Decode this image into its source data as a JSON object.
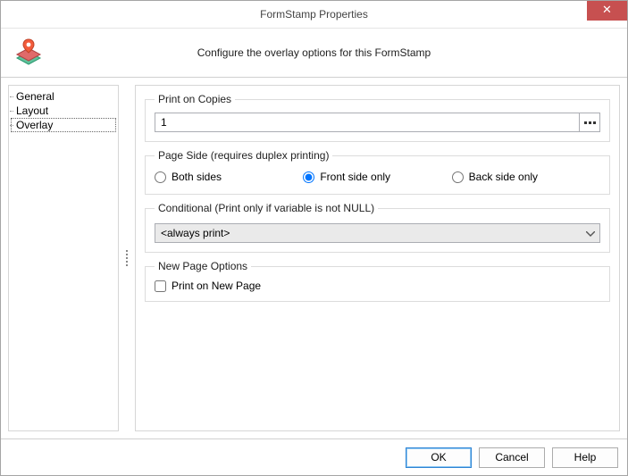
{
  "title": "FormStamp Properties",
  "subtitle": "Configure the overlay options for this FormStamp",
  "tree": {
    "items": [
      "General",
      "Layout",
      "Overlay"
    ],
    "selected_index": 2
  },
  "groups": {
    "print_on_copies": {
      "legend": "Print on Copies",
      "value": "1"
    },
    "page_side": {
      "legend": "Page Side (requires duplex printing)",
      "options": {
        "both": "Both sides",
        "front": "Front side only",
        "back": "Back side only"
      },
      "selected": "front"
    },
    "conditional": {
      "legend": "Conditional (Print only if variable is not NULL)",
      "value": "<always print>"
    },
    "new_page": {
      "legend": "New Page Options",
      "checkbox_label": "Print on New Page",
      "checked": false
    }
  },
  "buttons": {
    "ok": "OK",
    "cancel": "Cancel",
    "help": "Help"
  }
}
